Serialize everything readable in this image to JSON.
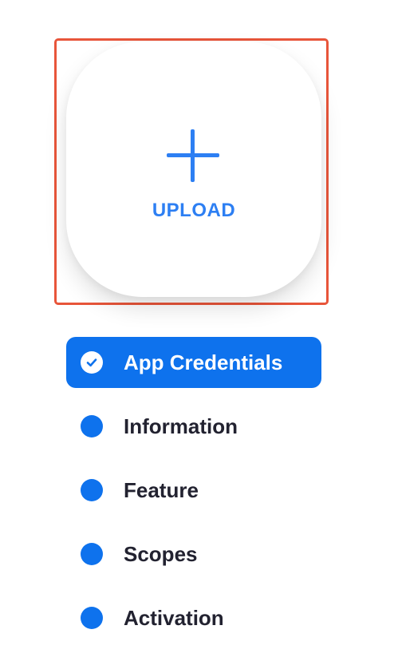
{
  "upload": {
    "label": "UPLOAD",
    "icon": "plus-icon"
  },
  "steps": [
    {
      "label": "App Credentials",
      "status": "completed",
      "icon": "check-icon"
    },
    {
      "label": "Information",
      "status": "pending"
    },
    {
      "label": "Feature",
      "status": "pending"
    },
    {
      "label": "Scopes",
      "status": "pending"
    },
    {
      "label": "Activation",
      "status": "pending"
    }
  ],
  "colors": {
    "accent": "#0e72ed",
    "upload_text": "#2d7ff3",
    "highlight_border": "#e8553a",
    "step_text": "#222230"
  }
}
